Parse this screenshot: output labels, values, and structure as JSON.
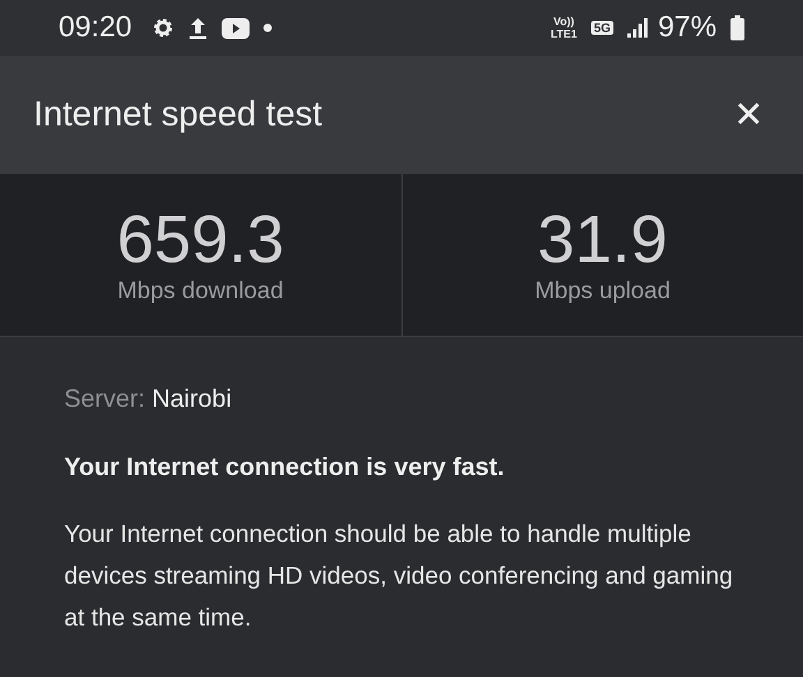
{
  "status_bar": {
    "time": "09:20",
    "volte_top": "Vo))",
    "volte_bottom": "LTE1",
    "network": "5G",
    "battery": "97%"
  },
  "dialog": {
    "title": "Internet speed test",
    "close": "✕"
  },
  "results": [
    {
      "value": "659.3",
      "label": "Mbps download"
    },
    {
      "value": "31.9",
      "label": "Mbps upload"
    }
  ],
  "server": {
    "label": "Server:",
    "value": "Nairobi"
  },
  "verdict": "Your Internet connection is very fast.",
  "description": "Your Internet connection should be able to handle multiple devices streaming HD videos, video conferencing and gaming at the same time."
}
